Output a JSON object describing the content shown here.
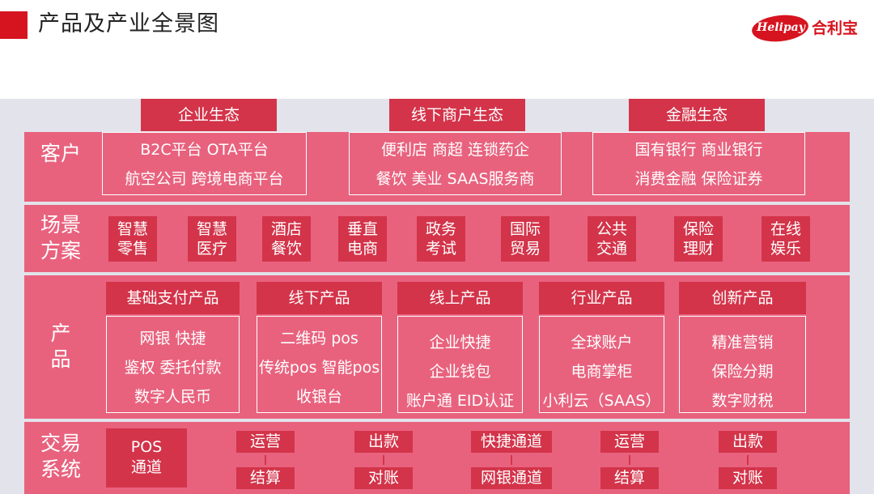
{
  "header": {
    "title": "产品及产业全景图",
    "logo_text_en": "Helipay",
    "logo_text_cn": "合利宝",
    "accent_color": "#d6141f"
  },
  "ecosystems": [
    "企业生态",
    "线下商户生态",
    "金融生态"
  ],
  "rows": {
    "customer": {
      "label": "客户",
      "groups": [
        [
          "B2C平台  OTA平台",
          "航空公司  跨境电商平台"
        ],
        [
          "便利店  商超  连锁药企",
          "餐饮  美业  SAAS服务商"
        ],
        [
          "国有银行  商业银行",
          "消费金融  保险证券"
        ]
      ]
    },
    "scenario": {
      "label_line1": "场景",
      "label_line2": "方案",
      "items": [
        [
          "智慧",
          "零售"
        ],
        [
          "智慧",
          "医疗"
        ],
        [
          "酒店",
          "餐饮"
        ],
        [
          "垂直",
          "电商"
        ],
        [
          "政务",
          "考试"
        ],
        [
          "国际",
          "贸易"
        ],
        [
          "公共",
          "交通"
        ],
        [
          "保险",
          "理财"
        ],
        [
          "在线",
          "娱乐"
        ]
      ]
    },
    "product": {
      "label_line1": "产",
      "label_line2": "品",
      "categories": [
        {
          "title": "基础支付产品",
          "items": [
            "网银   快捷",
            "鉴权   委托付款",
            "数字人民币"
          ]
        },
        {
          "title": "线下产品",
          "items": [
            "二维码 pos",
            "传统pos 智能pos",
            "收银台"
          ]
        },
        {
          "title": "线上产品",
          "items": [
            "企业快捷",
            "企业钱包",
            "账户通 EID认证"
          ]
        },
        {
          "title": "行业产品",
          "items": [
            "全球账户",
            "电商掌柜",
            "小利云（SAAS）"
          ]
        },
        {
          "title": "创新产品",
          "items": [
            "精准营销",
            "保险分期",
            "数字财税"
          ]
        }
      ]
    },
    "transaction": {
      "label_line1": "交易",
      "label_line2": "系统",
      "pos_line1": "POS",
      "pos_line2": "通道",
      "pairs": [
        [
          "运营",
          "结算"
        ],
        [
          "出款",
          "对账"
        ],
        [
          "快捷通道",
          "网银通道"
        ],
        [
          "运营",
          "结算"
        ],
        [
          "出款",
          "对账"
        ]
      ]
    }
  },
  "colors": {
    "band": "#e8627e",
    "box_dark": "#d3344a",
    "background": "#e2e3eb"
  }
}
